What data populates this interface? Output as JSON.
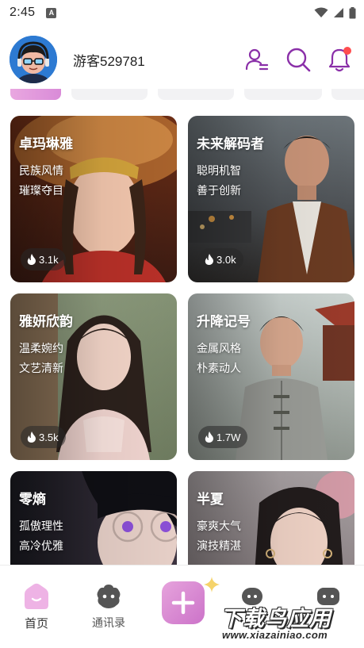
{
  "status_bar": {
    "time": "2:45",
    "app_badge": "A"
  },
  "header": {
    "username": "游客529781",
    "notification_dot_color": "#ff4d4f",
    "icon_color": "#8a2fa8"
  },
  "tabs": {
    "active_index": 0
  },
  "cards": [
    {
      "name": "卓玛琳雅",
      "tags": [
        "民族风情",
        "璀璨夺目"
      ],
      "heat": "3.1k"
    },
    {
      "name": "未来解码者",
      "tags": [
        "聪明机智",
        "善于创新"
      ],
      "heat": "3.0k"
    },
    {
      "name": "雅妍欣韵",
      "tags": [
        "温柔婉约",
        "文艺清新"
      ],
      "heat": "3.5k"
    },
    {
      "name": "升降记号",
      "tags": [
        "金属风格",
        "朴素动人"
      ],
      "heat": "1.7W"
    },
    {
      "name": "零熵",
      "tags": [
        "孤傲理性",
        "高冷优雅"
      ]
    },
    {
      "name": "半夏",
      "tags": [
        "豪爽大气",
        "演技精湛"
      ]
    }
  ],
  "bottom_nav": {
    "home_label": "首页",
    "contacts_label": "通讯录",
    "create_icon": "plus-icon",
    "accent": "#d98bd8"
  },
  "watermark": {
    "title": "下载鸟应用",
    "url": "www.xiazainiao.com"
  }
}
